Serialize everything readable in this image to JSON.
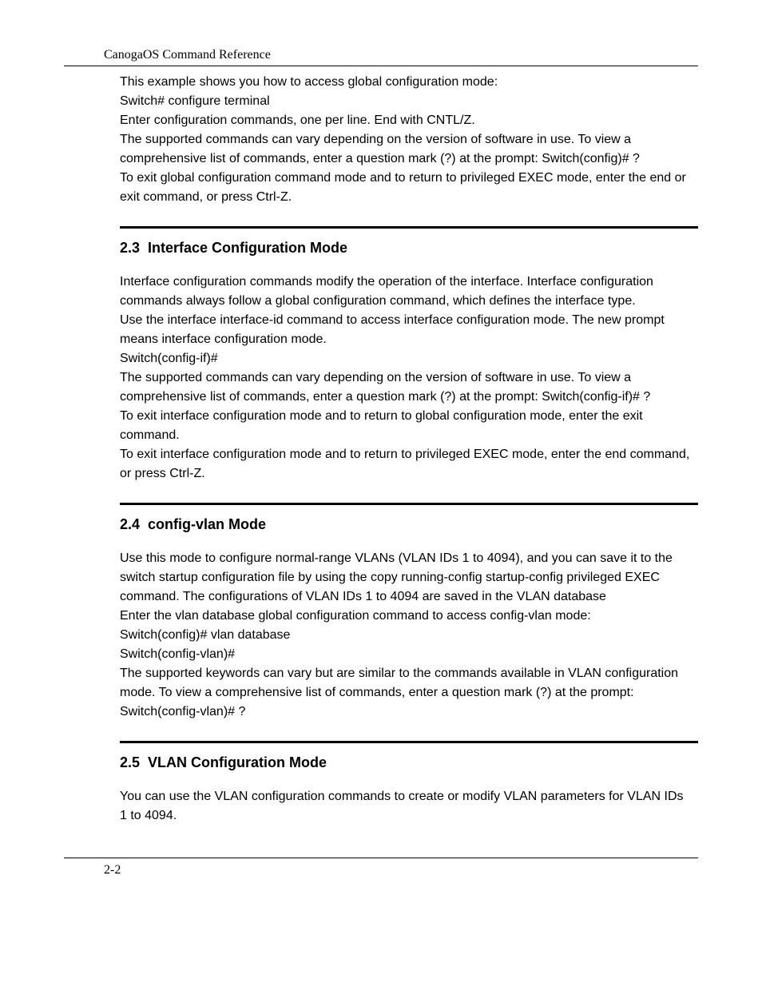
{
  "header": {
    "title": "CanogaOS  Command  Reference"
  },
  "section_top": {
    "p1": "This example shows you how to access global configuration mode:",
    "p2": "Switch# configure terminal",
    "p3": "Enter configuration commands, one per line. End with CNTL/Z.",
    "p4": "The supported commands can vary depending on the version of software in use. To view a comprehensive list of commands, enter a question mark (?) at the prompt: Switch(config)# ?",
    "p5": "To exit global configuration command mode and to return to privileged EXEC mode, enter the end or exit command, or press Ctrl-Z."
  },
  "section_23": {
    "heading": "2.3  Interface Configuration Mode",
    "p1": "Interface configuration commands modify the operation of the interface. Interface configuration commands always follow a global configuration command, which defines the interface type.",
    "p2": "Use the interface interface-id command to access interface configuration mode. The new prompt means interface configuration mode.",
    "p3": "Switch(config-if)#",
    "p4": "The supported commands can vary depending on the version of software in use. To view a comprehensive list of commands, enter a question mark (?) at the prompt: Switch(config-if)# ?",
    "p5": "To exit interface configuration mode and to return to global configuration mode, enter the exit command.",
    "p6": "To exit interface configuration mode and to return to privileged EXEC mode, enter the end command, or press Ctrl-Z."
  },
  "section_24": {
    "heading": "2.4  config-vlan Mode",
    "p1": "Use this mode to configure normal-range VLANs (VLAN IDs 1 to 4094), and you can save it to the switch startup configuration file by using the copy running-config startup-config privileged EXEC command. The configurations of VLAN IDs 1 to 4094 are saved in the VLAN database",
    "p2": "Enter the vlan database global configuration command to access config-vlan mode:",
    "p3": "Switch(config)# vlan database",
    "p4": "Switch(config-vlan)#",
    "p5": "The supported keywords can vary but are similar to the commands available in VLAN configuration mode. To view a comprehensive list of commands, enter a question mark (?) at the prompt:",
    "p6": "Switch(config-vlan)# ?"
  },
  "section_25": {
    "heading": "2.5  VLAN Configuration Mode",
    "p1": "You can use the VLAN configuration commands to create or modify VLAN parameters for VLAN IDs 1 to 4094."
  },
  "footer": {
    "page": "2-2"
  }
}
